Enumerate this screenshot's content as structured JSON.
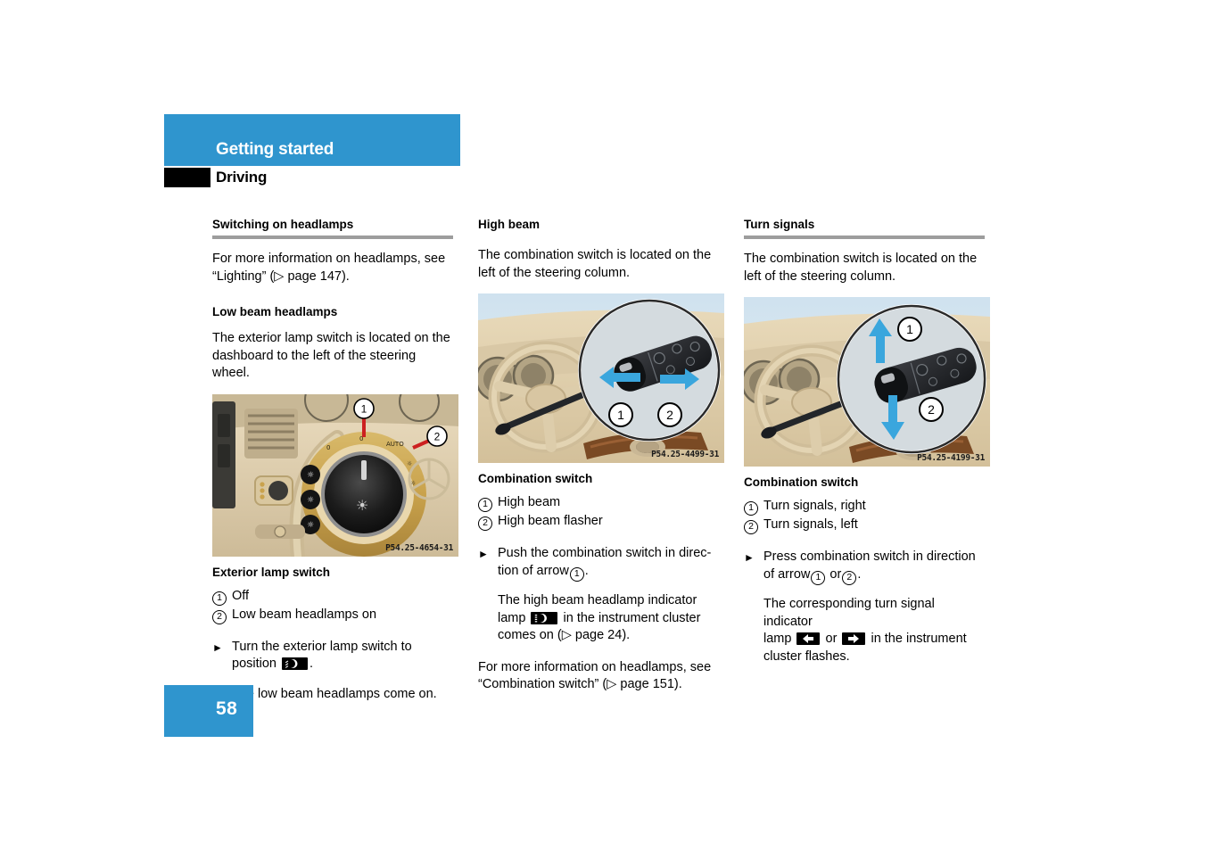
{
  "colors": {
    "brand_blue": "#2f95ce",
    "rule_gray": "#9d9d9d"
  },
  "header": {
    "chapter_title": "Getting started",
    "section_title": "Driving"
  },
  "footer": {
    "page_number": "58"
  },
  "columns": {
    "left": {
      "heading": "Switching on headlamps",
      "intro_paragraph": "For more information on headlamps, see “Lighting” (▷ page 147).",
      "subheading": "Low beam headlamps",
      "subheading_paragraph": "The exterior lamp switch is located on the dashboard to the left of the steering wheel.",
      "figure": {
        "alt": "Exterior lamp switch on dashboard left of steering wheel",
        "code": "P54.25-4654-31",
        "callouts": [
          "1",
          "2"
        ]
      },
      "caption": "Exterior lamp switch",
      "legend": [
        {
          "num": "1",
          "text": "Off"
        },
        {
          "num": "2",
          "text": "Low beam headlamps on"
        }
      ],
      "action_text_1": "Turn the exterior lamp switch to position",
      "action_icon_name": "low-beam-headlamp-icon",
      "action_text_after_icon": ".",
      "result_text": "The low beam headlamps come on."
    },
    "middle": {
      "heading": "High beam",
      "intro_paragraph": "The combination switch is located on the left of the steering column.",
      "figure": {
        "alt": "Combination switch push direction for high beam",
        "code": "P54.25-4499-31",
        "callouts": [
          "1",
          "2"
        ]
      },
      "caption": "Combination switch",
      "legend": [
        {
          "num": "1",
          "text": "High beam"
        },
        {
          "num": "2",
          "text": "High beam flasher"
        }
      ],
      "action_text_1": "Push the combination switch in direc-",
      "action_text_2": "tion of arrow",
      "action_arrow_num": "1",
      "action_text_after": ".",
      "result_text_1": "The high beam headlamp indicator",
      "result_text_2": "lamp",
      "result_icon_name": "high-beam-indicator-icon",
      "result_text_3": "in the instrument cluster",
      "result_text_4": "comes on (▷ page 24).",
      "closing_paragraph": "For more information on headlamps, see “Combination switch” (▷ page 151)."
    },
    "right": {
      "heading": "Turn signals",
      "intro_paragraph": "The combination switch is located on the left of the steering column.",
      "figure": {
        "alt": "Combination switch press direction for turn signals",
        "code": "P54.25-4199-31",
        "callouts": [
          "1",
          "2"
        ]
      },
      "caption": "Combination switch",
      "legend": [
        {
          "num": "1",
          "text": "Turn signals, right"
        },
        {
          "num": "2",
          "text": "Turn signals, left"
        }
      ],
      "action_text_1": "Press combination switch in direction",
      "action_text_2": "of arrow",
      "action_arrow_num_1": "1",
      "action_text_or": "or",
      "action_arrow_num_2": "2",
      "action_text_after": ".",
      "result_text_1": "The corresponding turn signal indicator",
      "result_text_2": "lamp",
      "result_icon_left_name": "turn-signal-left-icon",
      "result_text_or": "or",
      "result_icon_right_name": "turn-signal-right-icon",
      "result_text_3": "in the instrument",
      "result_text_4": "cluster flashes."
    }
  }
}
